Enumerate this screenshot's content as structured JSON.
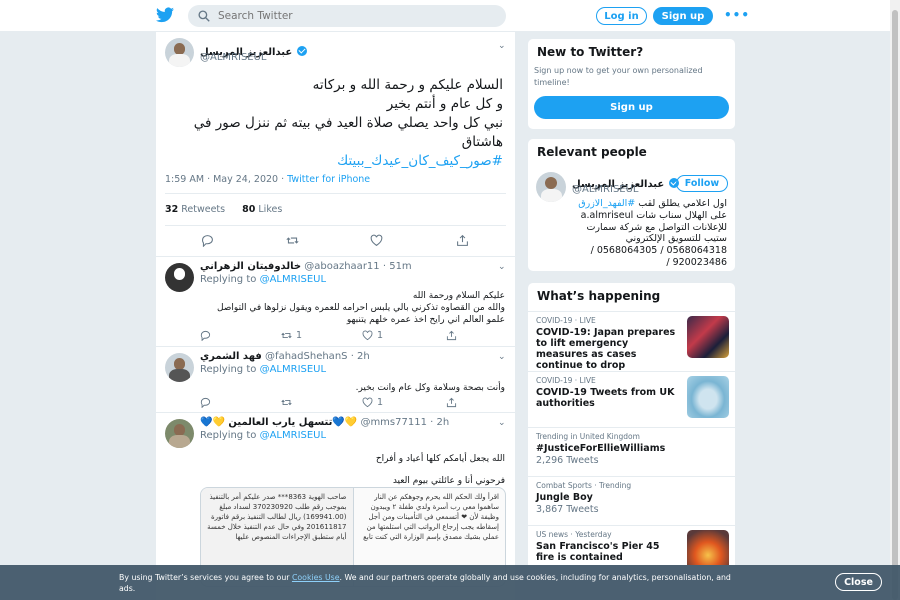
{
  "topbar": {
    "search_placeholder": "Search Twitter",
    "login_label": "Log in",
    "signup_label": "Sign up",
    "more_label": "•••"
  },
  "main_tweet": {
    "author_name": "عبدالعزيز المريسل",
    "author_handle": "@ALMRISEUL",
    "text_line1": "السلام عليكم و رحمة الله و بركاته",
    "text_line2": "و كل عام و أنتم بخير",
    "text_line3": "نبي كل واحد يصلي صلاة العيد في بيته ثم ننزل صور في هاشتاق",
    "hashtag": "#صور_كيف_كان_عيدك_ببيتك",
    "time": "1:59 AM · May 24, 2020 · ",
    "source": "Twitter for iPhone",
    "retweets_count": "32",
    "retweets_label": "Retweets",
    "likes_count": "80",
    "likes_label": "Likes"
  },
  "replies": [
    {
      "name": "خالدوفيتان الزهراني",
      "handle": "@aboazhaar11",
      "time": "· 51m",
      "replying_prefix": "Replying to",
      "replying_to": "@ALMRISEUL",
      "text_line1": "عليكم السلام ورحمة الله",
      "text_line2": "والله من القصاوه تذكرني  بالي يلبس احرامه للعمره  ويقول نزلوها في التواصل",
      "text_line3": "علمو العالم  اني  رايح اخذ عمره  خلهم يتنبهو",
      "replies": "",
      "retweets": "1",
      "likes": "1"
    },
    {
      "name": "فهد الشمري",
      "handle": "@fahadShehanS",
      "time": "· 2h",
      "replying_prefix": "Replying to",
      "replying_to": "@ALMRISEUL",
      "text_line1": "وأنت بصحة وسلامة وكل عام وانت بخير.",
      "replies": "",
      "retweets": "",
      "likes": "1"
    },
    {
      "name": "💙💛 تتسهل يارب العالمين💙💛",
      "handle": "@mms77111",
      "time": "· 2h",
      "replying_prefix": "Replying to",
      "replying_to": "@ALMRISEUL",
      "text_line1": "الله يجعل أيامكم كلها أعياد و أفراح",
      "text_line2": "فرحوني أنا و عائلتي بيوم العيد",
      "media_left": "صاحب الهوية 8363*** صدر عليكم أمر بالتنفيذ بموجب رقم طلب 370230920 لسداد مبلغ (169941.00) ريال لطالب التنفيذ برقم فاتورة 201611817 وفي حال عدم التنفيذ خلال خمسة أيام ستطبق الإجراءات المنصوص عليها",
      "media_right": "اقرأ ولك الحكم  الله يحرم وجوهكم عن النار ساهموا معي  رب أسرة ولدي طفلة ٢ ويبدون وظيفة  لأن ❤ أتسمعي في التأمينات ومن أجل إسقاطه  يجب إرجاع الرواتب التي استلمتها من عملي  بشيك مصدق بإسم الوزارة التي كنت تابع"
    }
  ],
  "sidebar": {
    "new_title": "New to Twitter?",
    "new_subtitle": "Sign up now to get your own personalized timeline!",
    "new_signup_label": "Sign up",
    "relevant_title": "Relevant people",
    "relevant_name": "عبدالعزيز المريسل",
    "relevant_handle": "@ALMRISEUL",
    "follow_label": "Follow",
    "bio_line1_text": "اول اعلامي يطلق لقب ",
    "bio_hashtag": "#الفهد_الازرق",
    "bio_line2": "على الهلال سناب شات a.almriseul",
    "bio_line3": "للإعلانات التواصل مع شركة سمارت",
    "bio_line4": "ستيب للتسويق الإلكتروني",
    "bio_line5": "0568064318 / 0568064305 /",
    "bio_line6": "920023486 /",
    "happening_title": "What’s happening",
    "trends": [
      {
        "category": "COVID-19 · LIVE",
        "title": "COVID-19: Japan prepares to lift emergency measures as cases continue to drop",
        "count": ""
      },
      {
        "category": "COVID-19 · LIVE",
        "title": "COVID-19 Tweets from UK authorities",
        "count": ""
      },
      {
        "category": "Trending in United Kingdom",
        "title": "#JusticeForEllieWilliams",
        "count": "2,296 Tweets"
      },
      {
        "category": "Combat Sports · Trending",
        "title": "Jungle Boy",
        "count": "3,867 Tweets"
      },
      {
        "category": "US news · Yesterday",
        "title": "San Francisco's Pier 45 fire is contained",
        "count": ""
      }
    ]
  },
  "cookie": {
    "text_before": "By using Twitter’s services you agree to our ",
    "link": "Cookies Use",
    "text_after": ". We and our partners operate globally and use cookies, including for analytics, personalisation, and ads.",
    "close_label": "Close"
  }
}
